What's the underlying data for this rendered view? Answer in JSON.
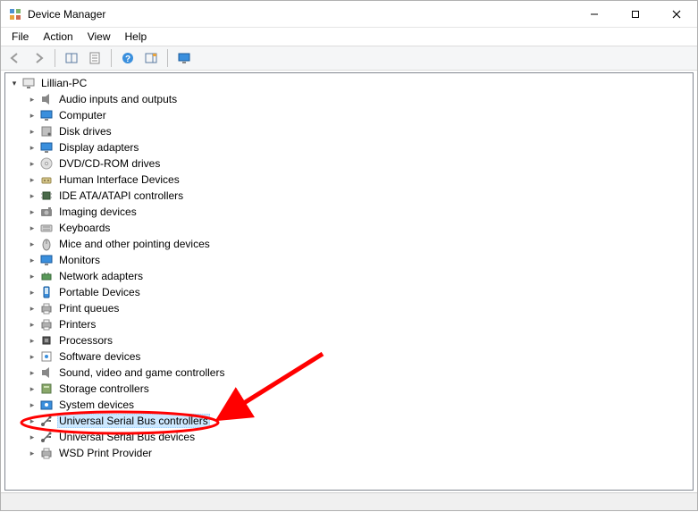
{
  "window": {
    "title": "Device Manager"
  },
  "menu": {
    "file": "File",
    "action": "Action",
    "view": "View",
    "help": "Help"
  },
  "toolbar": {
    "back": "Back",
    "forward": "Forward",
    "details_pane": "Show/Hide Console Pane",
    "properties": "Properties",
    "help": "Help",
    "more1": "Action Pane",
    "monitor": "Scan for hardware changes"
  },
  "tree": {
    "root": "Lillian-PC",
    "categories": [
      {
        "label": "Audio inputs and outputs",
        "icon": "speaker"
      },
      {
        "label": "Computer",
        "icon": "monitor"
      },
      {
        "label": "Disk drives",
        "icon": "disk"
      },
      {
        "label": "Display adapters",
        "icon": "monitor"
      },
      {
        "label": "DVD/CD-ROM drives",
        "icon": "disc"
      },
      {
        "label": "Human Interface Devices",
        "icon": "hid"
      },
      {
        "label": "IDE ATA/ATAPI controllers",
        "icon": "chip"
      },
      {
        "label": "Imaging devices",
        "icon": "camera"
      },
      {
        "label": "Keyboards",
        "icon": "keyboard"
      },
      {
        "label": "Mice and other pointing devices",
        "icon": "mouse"
      },
      {
        "label": "Monitors",
        "icon": "monitor"
      },
      {
        "label": "Network adapters",
        "icon": "network"
      },
      {
        "label": "Portable Devices",
        "icon": "portable"
      },
      {
        "label": "Print queues",
        "icon": "printer"
      },
      {
        "label": "Printers",
        "icon": "printer"
      },
      {
        "label": "Processors",
        "icon": "cpu"
      },
      {
        "label": "Software devices",
        "icon": "software"
      },
      {
        "label": "Sound, video and game controllers",
        "icon": "speaker"
      },
      {
        "label": "Storage controllers",
        "icon": "storage"
      },
      {
        "label": "System devices",
        "icon": "system"
      },
      {
        "label": "Universal Serial Bus controllers",
        "icon": "usb",
        "selected": true
      },
      {
        "label": "Universal Serial Bus devices",
        "icon": "usb"
      },
      {
        "label": "WSD Print Provider",
        "icon": "printer"
      }
    ]
  },
  "annotation": {
    "description": "Red ellipse circling 'Universal Serial Bus controllers' with an arrow pointing to it.",
    "color": "#ff0000"
  }
}
